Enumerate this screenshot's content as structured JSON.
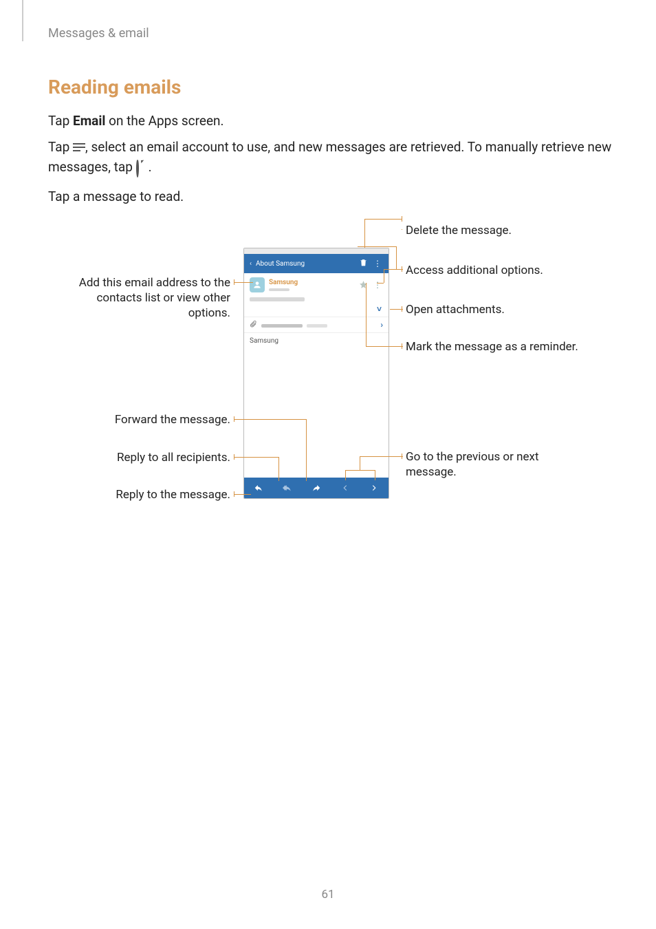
{
  "breadcrumb": "Messages & email",
  "heading": "Reading emails",
  "p1_a": "Tap ",
  "p1_b": "Email",
  "p1_c": " on the Apps screen.",
  "p2_a": "Tap ",
  "p2_b": ", select an email account to use, and new messages are retrieved. To manually retrieve new messages, tap ",
  "p2_c": ".",
  "p3": "Tap a message to read.",
  "phone": {
    "back": "‹",
    "title": "About Samsung",
    "sender": "Samsung",
    "body": "Samsung"
  },
  "callouts": {
    "delete": "Delete the message.",
    "options": "Access additional options.",
    "attach": "Open attachments.",
    "reminder": "Mark the message as a reminder.",
    "nav": "Go to the previous or next message.",
    "add": "Add this email address to the contacts list or view other options.",
    "forward": "Forward the message.",
    "reply_all": "Reply to all recipients.",
    "reply": "Reply to the message."
  },
  "page": "61",
  "chart_data": {
    "type": "diagram",
    "annotations": [
      {
        "target": "trash-icon",
        "label": "Delete the message."
      },
      {
        "target": "overflow-menu-icon",
        "label": "Access additional options."
      },
      {
        "target": "attachment-chevron",
        "label": "Open attachments."
      },
      {
        "target": "star-icon",
        "label": "Mark the message as a reminder."
      },
      {
        "target": "prev-next-buttons",
        "label": "Go to the previous or next message."
      },
      {
        "target": "sender-avatar",
        "label": "Add this email address to the contacts list or view other options."
      },
      {
        "target": "forward-button",
        "label": "Forward the message."
      },
      {
        "target": "reply-all-button",
        "label": "Reply to all recipients."
      },
      {
        "target": "reply-button",
        "label": "Reply to the message."
      }
    ]
  }
}
